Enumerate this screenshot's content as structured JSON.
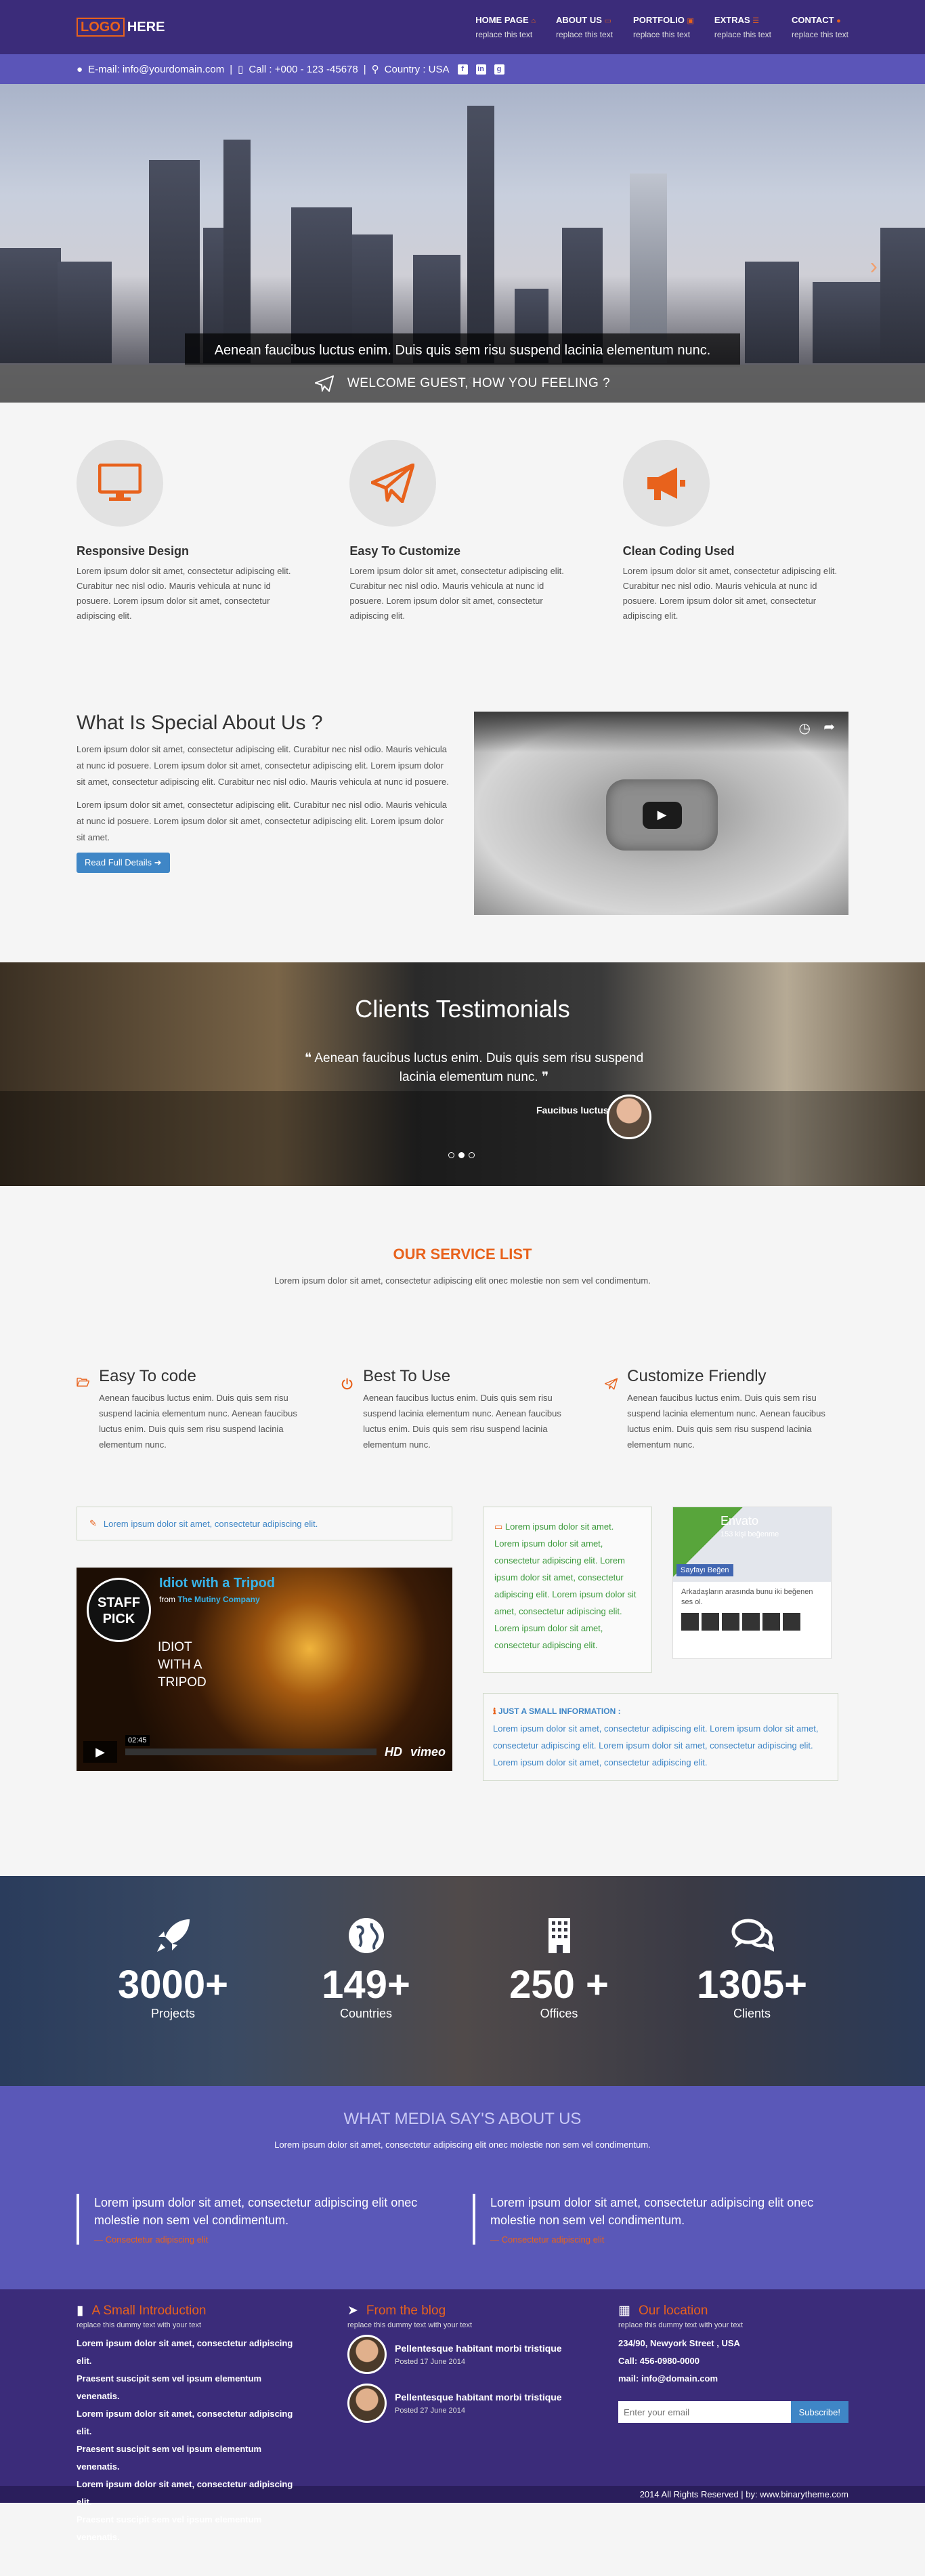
{
  "logo": {
    "box": "LOGO",
    "text": "HERE"
  },
  "nav": [
    {
      "label": "HOME PAGE",
      "icon": "home-icon",
      "glyph": "⌂",
      "sub": "replace this text"
    },
    {
      "label": "ABOUT US",
      "icon": "folder-icon",
      "glyph": "▭",
      "sub": "replace this text"
    },
    {
      "label": "PORTFOLIO",
      "icon": "image-icon",
      "glyph": "▣",
      "sub": "replace this text"
    },
    {
      "label": "EXTRAS",
      "icon": "list-icon",
      "glyph": "☰",
      "sub": "replace this text"
    },
    {
      "label": "CONTACT",
      "icon": "globe-icon",
      "glyph": "●",
      "sub": "replace this text"
    }
  ],
  "infobar": {
    "email": "E-mail: info@yourdomain.com",
    "call": "Call : +000 - 123 -45678",
    "country": "Country : USA"
  },
  "hero": {
    "caption": "Aenean faucibus luctus enim. Duis quis sem risu suspend lacinia elementum nunc.",
    "welcome": "WELCOME GUEST, HOW YOU FEELING ?"
  },
  "features": [
    {
      "icon": "monitor-icon",
      "title": "Responsive Design",
      "text": "Lorem ipsum dolor sit amet, consectetur adipiscing elit. Curabitur nec nisl odio. Mauris vehicula at nunc id posuere. Lorem ipsum dolor sit amet, consectetur adipiscing elit."
    },
    {
      "icon": "paper-plane-icon",
      "title": "Easy To Customize",
      "text": "Lorem ipsum dolor sit amet, consectetur adipiscing elit. Curabitur nec nisl odio. Mauris vehicula at nunc id posuere. Lorem ipsum dolor sit amet, consectetur adipiscing elit."
    },
    {
      "icon": "bullhorn-icon",
      "title": "Clean Coding Used",
      "text": "Lorem ipsum dolor sit amet, consectetur adipiscing elit. Curabitur nec nisl odio. Mauris vehicula at nunc id posuere. Lorem ipsum dolor sit amet, consectetur adipiscing elit."
    }
  ],
  "special": {
    "title": "What Is Special About Us ?",
    "p1": "Lorem ipsum dolor sit amet, consectetur adipiscing elit. Curabitur nec nisl odio. Mauris vehicula at nunc id posuere. Lorem ipsum dolor sit amet, consectetur adipiscing elit. Lorem ipsum dolor sit amet, consectetur adipiscing elit. Curabitur nec nisl odio. Mauris vehicula at nunc id posuere.",
    "p2": "Lorem ipsum dolor sit amet, consectetur adipiscing elit. Curabitur nec nisl odio. Mauris vehicula at nunc id posuere. Lorem ipsum dolor sit amet, consectetur adipiscing elit. Lorem ipsum dolor sit amet.",
    "button": "Read Full Details"
  },
  "testimonials": {
    "title": "Clients Testimonials",
    "quote": "Aenean faucibus luctus enim. Duis quis sem risu suspend lacinia elementum nunc.",
    "author": "Faucibus luctus"
  },
  "service_head": {
    "title": "OUR SERVICE LIST",
    "sub": "Lorem ipsum dolor sit amet, consectetur adipiscing elit onec molestie non sem vel condimentum."
  },
  "services": [
    {
      "icon": "folder-open-icon",
      "title": "Easy To code",
      "text": "Aenean faucibus luctus enim. Duis quis sem risu suspend lacinia elementum nunc. Aenean faucibus luctus enim. Duis quis sem risu suspend lacinia elementum nunc."
    },
    {
      "icon": "power-icon",
      "title": "Best To Use",
      "text": "Aenean faucibus luctus enim. Duis quis sem risu suspend lacinia elementum nunc. Aenean faucibus luctus enim. Duis quis sem risu suspend lacinia elementum nunc."
    },
    {
      "icon": "paper-plane-icon",
      "title": "Customize Friendly",
      "text": "Aenean faucibus luctus enim. Duis quis sem risu suspend lacinia elementum nunc. Aenean faucibus luctus enim. Duis quis sem risu suspend lacinia elementum nunc."
    }
  ],
  "widgets": {
    "note": "Lorem ipsum dolor sit amet, consectetur adipiscing elit.",
    "vimeo": {
      "title": "Idiot with a Tripod",
      "from": "from",
      "company": "The Mutiny Company",
      "badge": "STAFF PICK",
      "big": "IDIOT WITH A TRIPOD",
      "time": "02:45",
      "hd": "HD",
      "brand": "vimeo"
    },
    "box": "Lorem ipsum dolor sit amet. Lorem ipsum dolor sit amet, consectetur adipiscing elit. Lorem ipsum dolor sit amet, consectetur adipiscing elit. Lorem ipsum dolor sit amet, consectetur adipiscing elit. Lorem ipsum dolor sit amet, consectetur adipiscing elit.",
    "fb": {
      "name": "Envato",
      "likes": "153 kişi beğenme",
      "button": "Sayfayı Beğen",
      "text": "Arkadaşların arasında bunu iki beğenen ses ol."
    },
    "info_title": "JUST A SMALL INFORMATION :",
    "info_text": "Lorem ipsum dolor sit amet, consectetur adipiscing elit. Lorem ipsum dolor sit amet, consectetur adipiscing elit. Lorem ipsum dolor sit amet, consectetur adipiscing elit. Lorem ipsum dolor sit amet, consectetur adipiscing elit."
  },
  "stats": [
    {
      "icon": "rocket-icon",
      "num": "3000+",
      "label": "Projects"
    },
    {
      "icon": "globe-icon",
      "num": "149+",
      "label": "Countries"
    },
    {
      "icon": "building-icon",
      "num": "250 +",
      "label": "Offices"
    },
    {
      "icon": "comments-icon",
      "num": "1305+",
      "label": "Clients"
    }
  ],
  "media": {
    "title": "WHAT MEDIA SAY'S ABOUT US",
    "sub": "Lorem ipsum dolor sit amet, consectetur adipiscing elit onec molestie non sem vel condimentum.",
    "quotes": [
      {
        "text": "Lorem ipsum dolor sit amet, consectetur adipiscing elit onec molestie non sem vel condimentum.",
        "cite": "— Consectetur adipiscing elit"
      },
      {
        "text": "Lorem ipsum dolor sit amet, consectetur adipiscing elit onec molestie non sem vel condimentum.",
        "cite": "— Consectetur adipiscing elit"
      }
    ]
  },
  "footer": {
    "intro": {
      "title": "A Small Introduction",
      "sub": "replace this dummy text with your text",
      "lines": [
        "Lorem ipsum dolor sit amet, consectetur adipiscing elit.",
        "Praesent suscipit sem vel ipsum elementum venenatis.",
        "Lorem ipsum dolor sit amet, consectetur adipiscing elit.",
        "Praesent suscipit sem vel ipsum elementum venenatis.",
        "Lorem ipsum dolor sit amet, consectetur adipiscing elit.",
        "Praesent suscipit sem vel ipsum elementum venenatis."
      ]
    },
    "blog": {
      "title": "From the blog",
      "sub": "replace this dummy text with your text",
      "posts": [
        {
          "title": "Pellentesque habitant morbi tristique",
          "date": "Posted 17 June 2014"
        },
        {
          "title": "Pellentesque habitant morbi tristique",
          "date": "Posted 27 June 2014"
        }
      ]
    },
    "location": {
      "title": "Our location",
      "sub": "replace this dummy text with your text",
      "address": "234/90, Newyork Street , USA",
      "call": "Call: 456-0980-0000",
      "mail": "mail: info@domain.com",
      "placeholder": "Enter your email",
      "button": "Subscribe!"
    },
    "copyright": "2014 All Rights Reserved | by: www.binarytheme.com"
  },
  "colors": {
    "navy": "#3b2c7a",
    "accent": "#e8621c",
    "violet": "#5b55b8",
    "blue": "#3f86c6"
  }
}
